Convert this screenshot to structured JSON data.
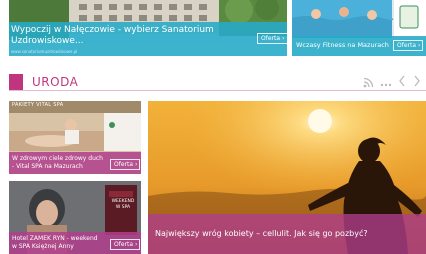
{
  "top_banners": [
    {
      "title": "Wypoczij w Nałęczowie - wybierz Sanatorium Uzdrowiskowe...",
      "url": "www.sanatoriumuzdrowiskowe.pl",
      "button": "Oferta"
    },
    {
      "title": "Wczasy Fitness na Mazurach",
      "button": "Oferta"
    }
  ],
  "section": {
    "title": "URODA",
    "accent": "#c0367e",
    "icons": [
      "rss-icon",
      "more-dots-icon",
      "chevron-left-icon",
      "chevron-right-icon"
    ]
  },
  "small_cards": [
    {
      "header": "PAKIETY VITAL SPA",
      "caption": "W zdrowym ciele zdrowy duch - Vital SPA na Mazurach",
      "button": "Oferta"
    },
    {
      "header": "WEEKEND W SPA",
      "caption": "Hotel ZAMEK RYN - weekend w SPA Księżnej Anny",
      "button": "Oferta"
    }
  ],
  "feature": {
    "caption": "Największy wróg kobiety – cellulit. Jak się go pozbyć?"
  }
}
